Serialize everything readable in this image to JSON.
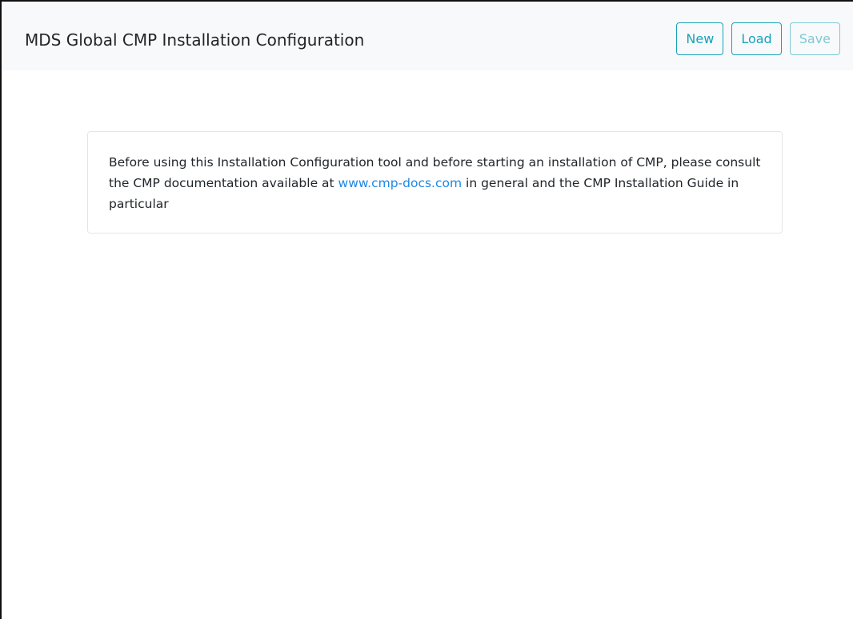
{
  "header": {
    "title": "MDS Global CMP Installation Configuration",
    "buttons": {
      "new_label": "New",
      "load_label": "Load",
      "save_label": "Save"
    }
  },
  "notice": {
    "text_before_link": "Before using this Installation Configuration tool and before starting an installation of CMP, please consult the CMP documentation available at ",
    "link_text": "www.cmp-docs.com",
    "text_after_link": " in general and the CMP Installation Guide in particular"
  },
  "colors": {
    "accent": "#17a2b8",
    "link": "#1e88e5",
    "navbar_bg": "#f8f9fa",
    "text": "#212529"
  }
}
